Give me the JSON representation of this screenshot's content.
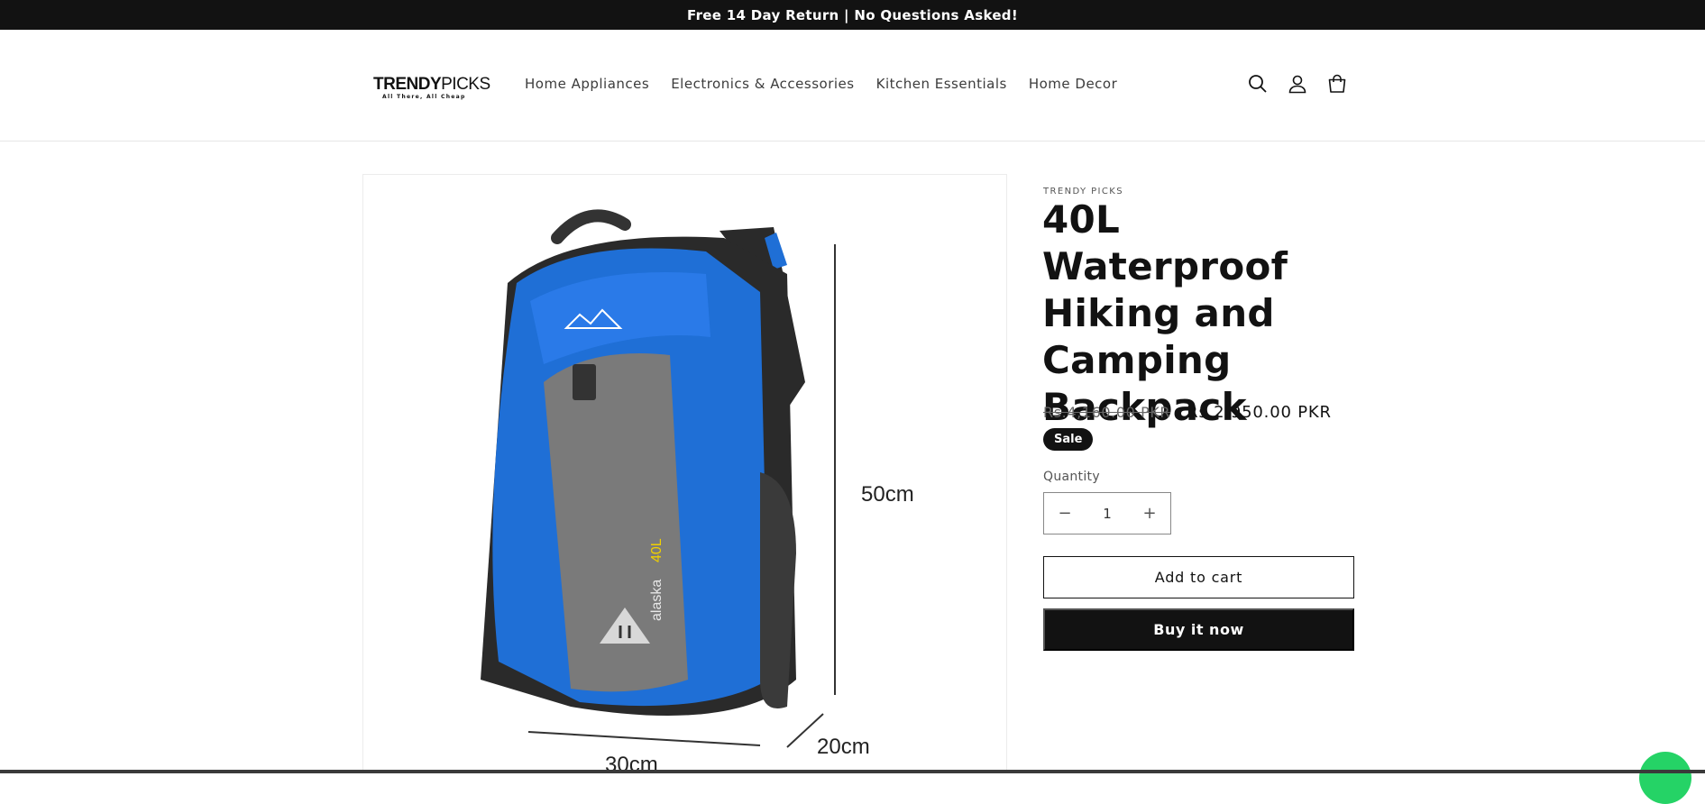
{
  "announcement": "Free 14 Day Return | No Questions Asked!",
  "logo": {
    "main_bold": "TRE",
    "main_mid": "NDY",
    "main_tail": "PICKS",
    "tagline": "All There, All Cheap"
  },
  "nav": [
    "Home Appliances",
    "Electronics & Accessories",
    "Kitchen Essentials",
    "Home Decor"
  ],
  "header_icons": [
    "search-icon",
    "account-icon",
    "cart-icon"
  ],
  "product": {
    "vendor": "TRENDY PICKS",
    "title": "40L Waterproof Hiking and Camping Backpack",
    "price_old": "Rs.4,160.00 PKR",
    "price_new": "Rs.2,950.00 PKR",
    "badge": "Sale",
    "quantity_label": "Quantity",
    "quantity_value": "1",
    "add_to_cart": "Add to cart",
    "buy_now": "Buy it now"
  },
  "image_labels": {
    "height": "50cm",
    "depth": "20cm",
    "width": "30cm",
    "brand_text": "alaska 40L"
  },
  "colors": {
    "accent": "#121212",
    "backpack_blue": "#1f6fd6",
    "backpack_grey": "#7a7a7a",
    "chat": "#25d366"
  }
}
